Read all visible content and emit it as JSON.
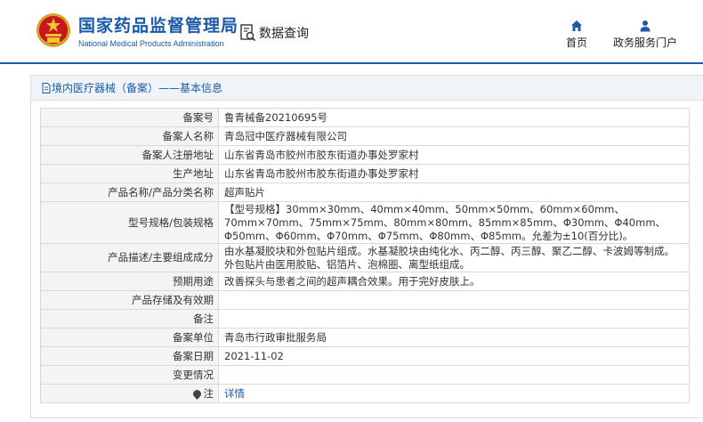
{
  "header": {
    "logo_title_cn": "国家药品监督管理局",
    "logo_title_en": "National Medical Products Administration",
    "data_query_label": "数据查询",
    "nav": [
      {
        "label": "首页",
        "icon": "home-icon"
      },
      {
        "label": "政务服务门户",
        "icon": "user-icon"
      }
    ]
  },
  "panel": {
    "title": "境内医疗器械（备案）——基本信息"
  },
  "rows": [
    {
      "label": "备案号",
      "value": "鲁青械备20210695号"
    },
    {
      "label": "备案人名称",
      "value": "青岛冠中医疗器械有限公司"
    },
    {
      "label": "备案人注册地址",
      "value": "山东省青岛市胶州市胶东街道办事处罗家村"
    },
    {
      "label": "生产地址",
      "value": "山东省青岛市胶州市胶东街道办事处罗家村"
    },
    {
      "label": "产品名称/产品分类名称",
      "value": "超声贴片"
    },
    {
      "label": "型号规格/包装规格",
      "value": "【型号规格】30mm×30mm、40mm×40mm、50mm×50mm、60mm×60mm、70mm×70mm、75mm×75mm、80mm×80mm、85mm×85mm、Φ30mm、Φ40mm、Φ50mm、Φ60mm、Φ70mm、Φ75mm、Φ80mm、Φ85mm。允差为±10(百分比)。"
    },
    {
      "label": "产品描述/主要组成成分",
      "value": "由水基凝胶块和外包贴片组成。水基凝胶块由纯化水、丙二醇、丙三醇、聚乙二醇、卡波姆等制成。外包贴片由医用胶贴、铝箔片、泡棉圈、离型纸组成。"
    },
    {
      "label": "预期用途",
      "value": "改善探头与患者之间的超声耦合效果。用于完好皮肤上。"
    },
    {
      "label": "产品存储及有效期",
      "value": ""
    },
    {
      "label": "备注",
      "value": ""
    },
    {
      "label": "备案单位",
      "value": "青岛市行政审批服务局"
    },
    {
      "label": "备案日期",
      "value": "2021-11-02"
    },
    {
      "label": "变更情况",
      "value": ""
    },
    {
      "label": "注",
      "value": "详情"
    }
  ]
}
